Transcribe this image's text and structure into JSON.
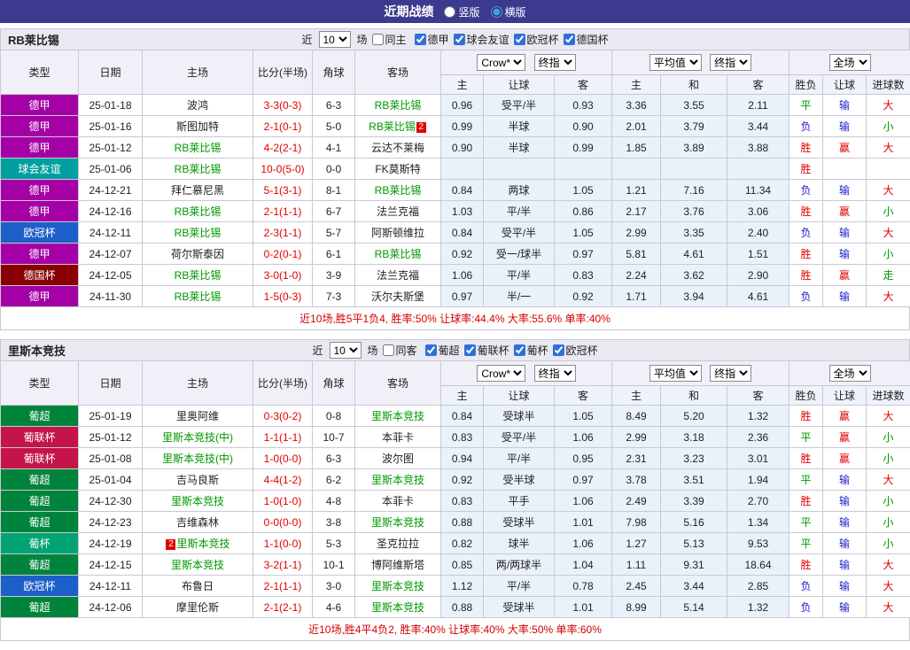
{
  "page": {
    "title": "近期战绩",
    "view_vertical": "竖版",
    "view_horizontal": "横版"
  },
  "common": {
    "near_label": "近",
    "rounds_value": "10",
    "matches_label": "场",
    "col_headers": [
      "类型",
      "日期",
      "主场",
      "比分(半场)",
      "角球",
      "客场"
    ],
    "odds_selects": {
      "crow": "Crow*",
      "final": "终指",
      "avg": "平均值",
      "full": "全场"
    },
    "sub_headers": [
      "主",
      "让球",
      "客",
      "主",
      "和",
      "客",
      "胜负",
      "让球",
      "进球数"
    ]
  },
  "colors": {
    "red": "#e10000",
    "blue": "#1b1bd1",
    "green": "#009700",
    "focus_team": "#009700",
    "topbar_bg": "#3c3a8e",
    "accent": "#2f6fd6",
    "league": {
      "德甲": "#a500a5",
      "球会友谊": "#00a0a0",
      "欧冠杯": "#1d5fc9",
      "德国杯": "#8a0000",
      "葡超": "#00843c",
      "葡联杯": "#c41448",
      "葡杯": "#00a473"
    }
  },
  "sections": [
    {
      "team": "RB莱比锡",
      "same_venue_label": "同主",
      "leagues": [
        "德甲",
        "球会友谊",
        "欧冠杯",
        "德国杯"
      ],
      "footer": "近10场,胜5平1负4, 胜率:50% 让球率:44.4% 大率:55.6% 单率:40%",
      "rows": [
        {
          "league": "德甲",
          "date": "25-01-18",
          "home": {
            "name": "波鸿"
          },
          "score": "3-3(0-3)",
          "corners": "6-3",
          "away": {
            "name": "RB莱比锡",
            "focus": true
          },
          "final": [
            "0.96",
            "受平/半",
            "0.93"
          ],
          "avg": [
            "3.36",
            "3.55",
            "2.11"
          ],
          "result": {
            "text": "平",
            "color": "green"
          },
          "handicap": {
            "text": "输",
            "color": "blue"
          },
          "goals": {
            "text": "大",
            "color": "red"
          }
        },
        {
          "league": "德甲",
          "date": "25-01-16",
          "home": {
            "name": "斯图加特"
          },
          "score": "2-1(0-1)",
          "corners": "5-0",
          "away": {
            "name": "RB莱比锡",
            "focus": true,
            "badge_post": "2"
          },
          "final": [
            "0.99",
            "半球",
            "0.90"
          ],
          "avg": [
            "2.01",
            "3.79",
            "3.44"
          ],
          "result": {
            "text": "负",
            "color": "blue"
          },
          "handicap": {
            "text": "输",
            "color": "blue"
          },
          "goals": {
            "text": "小",
            "color": "green"
          }
        },
        {
          "league": "德甲",
          "date": "25-01-12",
          "home": {
            "name": "RB莱比锡",
            "focus": true
          },
          "score": "4-2(2-1)",
          "corners": "4-1",
          "away": {
            "name": "云达不莱梅"
          },
          "final": [
            "0.90",
            "半球",
            "0.99"
          ],
          "avg": [
            "1.85",
            "3.89",
            "3.88"
          ],
          "result": {
            "text": "胜",
            "color": "red"
          },
          "handicap": {
            "text": "赢",
            "color": "red"
          },
          "goals": {
            "text": "大",
            "color": "red"
          }
        },
        {
          "league": "球会友谊",
          "date": "25-01-06",
          "home": {
            "name": "RB莱比锡",
            "focus": true
          },
          "score": "10-0(5-0)",
          "corners": "0-0",
          "away": {
            "name": "FK莫斯特"
          },
          "final": [
            "",
            "",
            ""
          ],
          "avg": [
            "",
            "",
            ""
          ],
          "result": {
            "text": "胜",
            "color": "red"
          },
          "handicap": {
            "text": "",
            "color": ""
          },
          "goals": {
            "text": "",
            "color": ""
          }
        },
        {
          "league": "德甲",
          "date": "24-12-21",
          "home": {
            "name": "拜仁慕尼黑"
          },
          "score": "5-1(3-1)",
          "corners": "8-1",
          "away": {
            "name": "RB莱比锡",
            "focus": true
          },
          "final": [
            "0.84",
            "两球",
            "1.05"
          ],
          "avg": [
            "1.21",
            "7.16",
            "11.34"
          ],
          "result": {
            "text": "负",
            "color": "blue"
          },
          "handicap": {
            "text": "输",
            "color": "blue"
          },
          "goals": {
            "text": "大",
            "color": "red"
          }
        },
        {
          "league": "德甲",
          "date": "24-12-16",
          "home": {
            "name": "RB莱比锡",
            "focus": true
          },
          "score": "2-1(1-1)",
          "corners": "6-7",
          "away": {
            "name": "法兰克福"
          },
          "final": [
            "1.03",
            "平/半",
            "0.86"
          ],
          "avg": [
            "2.17",
            "3.76",
            "3.06"
          ],
          "result": {
            "text": "胜",
            "color": "red"
          },
          "handicap": {
            "text": "赢",
            "color": "red"
          },
          "goals": {
            "text": "小",
            "color": "green"
          }
        },
        {
          "league": "欧冠杯",
          "date": "24-12-11",
          "home": {
            "name": "RB莱比锡",
            "focus": true
          },
          "score": "2-3(1-1)",
          "corners": "5-7",
          "away": {
            "name": "阿斯顿维拉"
          },
          "final": [
            "0.84",
            "受平/半",
            "1.05"
          ],
          "avg": [
            "2.99",
            "3.35",
            "2.40"
          ],
          "result": {
            "text": "负",
            "color": "blue"
          },
          "handicap": {
            "text": "输",
            "color": "blue"
          },
          "goals": {
            "text": "大",
            "color": "red"
          }
        },
        {
          "league": "德甲",
          "date": "24-12-07",
          "home": {
            "name": "荷尔斯泰因"
          },
          "score": "0-2(0-1)",
          "corners": "6-1",
          "away": {
            "name": "RB莱比锡",
            "focus": true
          },
          "final": [
            "0.92",
            "受一/球半",
            "0.97"
          ],
          "avg": [
            "5.81",
            "4.61",
            "1.51"
          ],
          "result": {
            "text": "胜",
            "color": "red"
          },
          "handicap": {
            "text": "输",
            "color": "blue"
          },
          "goals": {
            "text": "小",
            "color": "green"
          }
        },
        {
          "league": "德国杯",
          "date": "24-12-05",
          "home": {
            "name": "RB莱比锡",
            "focus": true
          },
          "score": "3-0(1-0)",
          "corners": "3-9",
          "away": {
            "name": "法兰克福"
          },
          "final": [
            "1.06",
            "平/半",
            "0.83"
          ],
          "avg": [
            "2.24",
            "3.62",
            "2.90"
          ],
          "result": {
            "text": "胜",
            "color": "red"
          },
          "handicap": {
            "text": "赢",
            "color": "red"
          },
          "goals": {
            "text": "走",
            "color": "green"
          }
        },
        {
          "league": "德甲",
          "date": "24-11-30",
          "home": {
            "name": "RB莱比锡",
            "focus": true
          },
          "score": "1-5(0-3)",
          "corners": "7-3",
          "away": {
            "name": "沃尔夫斯堡"
          },
          "final": [
            "0.97",
            "半/一",
            "0.92"
          ],
          "avg": [
            "1.71",
            "3.94",
            "4.61"
          ],
          "result": {
            "text": "负",
            "color": "blue"
          },
          "handicap": {
            "text": "输",
            "color": "blue"
          },
          "goals": {
            "text": "大",
            "color": "red"
          }
        }
      ]
    },
    {
      "team": "里斯本竞技",
      "same_venue_label": "同客",
      "leagues": [
        "葡超",
        "葡联杯",
        "葡杯",
        "欧冠杯"
      ],
      "footer": "近10场,胜4平4负2, 胜率:40% 让球率:40% 大率:50% 单率:60%",
      "rows": [
        {
          "league": "葡超",
          "date": "25-01-19",
          "home": {
            "name": "里奥阿维"
          },
          "score": "0-3(0-2)",
          "corners": "0-8",
          "away": {
            "name": "里斯本竞技",
            "focus": true
          },
          "final": [
            "0.84",
            "受球半",
            "1.05"
          ],
          "avg": [
            "8.49",
            "5.20",
            "1.32"
          ],
          "result": {
            "text": "胜",
            "color": "red"
          },
          "handicap": {
            "text": "赢",
            "color": "red"
          },
          "goals": {
            "text": "大",
            "color": "red"
          }
        },
        {
          "league": "葡联杯",
          "date": "25-01-12",
          "home": {
            "name": "里斯本竞技(中)",
            "focus": true
          },
          "score": "1-1(1-1)",
          "corners": "10-7",
          "away": {
            "name": "本菲卡"
          },
          "final": [
            "0.83",
            "受平/半",
            "1.06"
          ],
          "avg": [
            "2.99",
            "3.18",
            "2.36"
          ],
          "result": {
            "text": "平",
            "color": "green"
          },
          "handicap": {
            "text": "赢",
            "color": "red"
          },
          "goals": {
            "text": "小",
            "color": "green"
          }
        },
        {
          "league": "葡联杯",
          "date": "25-01-08",
          "home": {
            "name": "里斯本竞技(中)",
            "focus": true
          },
          "score": "1-0(0-0)",
          "corners": "6-3",
          "away": {
            "name": "波尔图"
          },
          "final": [
            "0.94",
            "平/半",
            "0.95"
          ],
          "avg": [
            "2.31",
            "3.23",
            "3.01"
          ],
          "result": {
            "text": "胜",
            "color": "red"
          },
          "handicap": {
            "text": "赢",
            "color": "red"
          },
          "goals": {
            "text": "小",
            "color": "green"
          }
        },
        {
          "league": "葡超",
          "date": "25-01-04",
          "home": {
            "name": "吉马良斯"
          },
          "score": "4-4(1-2)",
          "corners": "6-2",
          "away": {
            "name": "里斯本竞技",
            "focus": true
          },
          "final": [
            "0.92",
            "受半球",
            "0.97"
          ],
          "avg": [
            "3.78",
            "3.51",
            "1.94"
          ],
          "result": {
            "text": "平",
            "color": "green"
          },
          "handicap": {
            "text": "输",
            "color": "blue"
          },
          "goals": {
            "text": "大",
            "color": "red"
          }
        },
        {
          "league": "葡超",
          "date": "24-12-30",
          "home": {
            "name": "里斯本竞技",
            "focus": true
          },
          "score": "1-0(1-0)",
          "corners": "4-8",
          "away": {
            "name": "本菲卡"
          },
          "final": [
            "0.83",
            "平手",
            "1.06"
          ],
          "avg": [
            "2.49",
            "3.39",
            "2.70"
          ],
          "result": {
            "text": "胜",
            "color": "red"
          },
          "handicap": {
            "text": "输",
            "color": "blue"
          },
          "goals": {
            "text": "小",
            "color": "green"
          }
        },
        {
          "league": "葡超",
          "date": "24-12-23",
          "home": {
            "name": "吉维森林"
          },
          "score": "0-0(0-0)",
          "corners": "3-8",
          "away": {
            "name": "里斯本竞技",
            "focus": true
          },
          "final": [
            "0.88",
            "受球半",
            "1.01"
          ],
          "avg": [
            "7.98",
            "5.16",
            "1.34"
          ],
          "result": {
            "text": "平",
            "color": "green"
          },
          "handicap": {
            "text": "输",
            "color": "blue"
          },
          "goals": {
            "text": "小",
            "color": "green"
          }
        },
        {
          "league": "葡杯",
          "date": "24-12-19",
          "home": {
            "name": "里斯本竞技",
            "focus": true,
            "badge_pre": "2"
          },
          "score": "1-1(0-0)",
          "corners": "5-3",
          "away": {
            "name": "圣克拉拉"
          },
          "final": [
            "0.82",
            "球半",
            "1.06"
          ],
          "avg": [
            "1.27",
            "5.13",
            "9.53"
          ],
          "result": {
            "text": "平",
            "color": "green"
          },
          "handicap": {
            "text": "输",
            "color": "blue"
          },
          "goals": {
            "text": "小",
            "color": "green"
          }
        },
        {
          "league": "葡超",
          "date": "24-12-15",
          "home": {
            "name": "里斯本竞技",
            "focus": true
          },
          "score": "3-2(1-1)",
          "corners": "10-1",
          "away": {
            "name": "博阿维斯塔"
          },
          "final": [
            "0.85",
            "两/两球半",
            "1.04"
          ],
          "avg": [
            "1.11",
            "9.31",
            "18.64"
          ],
          "result": {
            "text": "胜",
            "color": "red"
          },
          "handicap": {
            "text": "输",
            "color": "blue"
          },
          "goals": {
            "text": "大",
            "color": "red"
          }
        },
        {
          "league": "欧冠杯",
          "date": "24-12-11",
          "home": {
            "name": "布鲁日"
          },
          "score": "2-1(1-1)",
          "corners": "3-0",
          "away": {
            "name": "里斯本竞技",
            "focus": true
          },
          "final": [
            "1.12",
            "平/半",
            "0.78"
          ],
          "avg": [
            "2.45",
            "3.44",
            "2.85"
          ],
          "result": {
            "text": "负",
            "color": "blue"
          },
          "handicap": {
            "text": "输",
            "color": "blue"
          },
          "goals": {
            "text": "大",
            "color": "red"
          }
        },
        {
          "league": "葡超",
          "date": "24-12-06",
          "home": {
            "name": "摩里伦斯"
          },
          "score": "2-1(2-1)",
          "corners": "4-6",
          "away": {
            "name": "里斯本竞技",
            "focus": true
          },
          "final": [
            "0.88",
            "受球半",
            "1.01"
          ],
          "avg": [
            "8.99",
            "5.14",
            "1.32"
          ],
          "result": {
            "text": "负",
            "color": "blue"
          },
          "handicap": {
            "text": "输",
            "color": "blue"
          },
          "goals": {
            "text": "大",
            "color": "red"
          }
        }
      ]
    }
  ]
}
